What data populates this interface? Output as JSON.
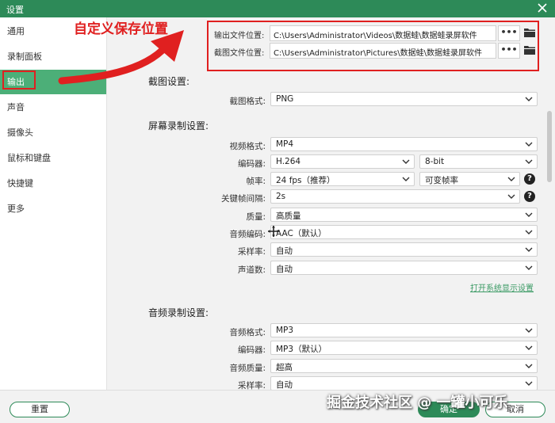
{
  "window": {
    "title": "设置"
  },
  "sidebar": {
    "items": [
      {
        "label": "通用"
      },
      {
        "label": "录制面板"
      },
      {
        "label": "输出"
      },
      {
        "label": "声音"
      },
      {
        "label": "摄像头"
      },
      {
        "label": "鼠标和键盘"
      },
      {
        "label": "快捷键"
      },
      {
        "label": "更多"
      }
    ],
    "active": "输出"
  },
  "annotation": {
    "text": "自定义保存位置",
    "color": "#e02020"
  },
  "paths": [
    {
      "label": "输出文件位置:",
      "value": "C:\\Users\\Administrator\\Videos\\数据蛙\\数据蛙录屏软件"
    },
    {
      "label": "截图文件位置:",
      "value": "C:\\Users\\Administrator\\Pictures\\数据蛙\\数据蛙录屏软件"
    }
  ],
  "screenshot": {
    "title": "截图设置:",
    "format_label": "截图格式:",
    "format_value": "PNG"
  },
  "screen": {
    "title": "屏幕录制设置:",
    "video_format_label": "视频格式:",
    "video_format": "MP4",
    "encoder_label": "编码器:",
    "encoder": "H.264",
    "bitdepth": "8-bit",
    "framerate_label": "帧率:",
    "framerate": "24 fps（推荐）",
    "framerate_mode": "可变帧率",
    "keyframe_label": "关键帧间隔:",
    "keyframe": "2s",
    "quality_label": "质量:",
    "quality": "高质量",
    "audio_codec_label": "音频编码:",
    "audio_codec": "AAC（默认）",
    "samplerate_label": "采样率:",
    "samplerate": "自动",
    "channels_label": "声道数:",
    "channels": "自动",
    "display_link": "打开系统显示设置"
  },
  "audio": {
    "title": "音频录制设置:",
    "format_label": "音频格式:",
    "format": "MP3",
    "encoder_label": "编码器:",
    "encoder": "MP3（默认）",
    "quality_label": "音频质量:",
    "quality": "超高",
    "samplerate_label": "采样率:",
    "samplerate": "自动"
  },
  "footer": {
    "reset": "重置",
    "ok": "确定",
    "cancel": "取消"
  },
  "watermark": "掘金技术社区 @ 一罐小可乐",
  "colors": {
    "accent": "#2d8a58",
    "active": "#4caf78",
    "annotation": "#e02020"
  }
}
